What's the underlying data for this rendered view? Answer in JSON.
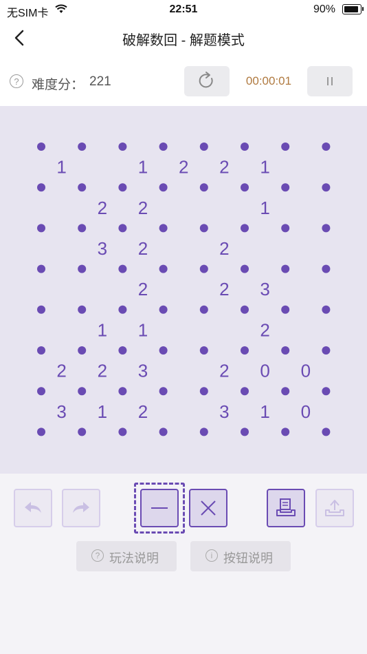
{
  "status_bar": {
    "carrier": "无SIM卡",
    "time": "22:51",
    "battery": "90%",
    "battery_level": 0.9
  },
  "nav": {
    "title": "破解数回 - 解题模式"
  },
  "info": {
    "difficulty_label": "难度分：",
    "difficulty_value": "221",
    "timer": "00:00:01"
  },
  "board": {
    "rows": 7,
    "cols": 7,
    "clues": [
      [
        "1",
        "",
        "1",
        "2",
        "2",
        "1",
        ""
      ],
      [
        "",
        "2",
        "2",
        "",
        "",
        "1",
        ""
      ],
      [
        "",
        "3",
        "2",
        "",
        "2",
        "",
        ""
      ],
      [
        "",
        "",
        "2",
        "",
        "2",
        "3",
        ""
      ],
      [
        "",
        "1",
        "1",
        "",
        "",
        "2",
        ""
      ],
      [
        "2",
        "2",
        "3",
        "",
        "2",
        "0",
        "0"
      ],
      [
        "3",
        "1",
        "2",
        "",
        "3",
        "1",
        "0"
      ]
    ]
  },
  "controls": {
    "help_rules": "玩法说明",
    "help_buttons": "按钮说明",
    "colors": {
      "accent": "#6a4bb3",
      "disabled": "#d6cdea"
    }
  }
}
